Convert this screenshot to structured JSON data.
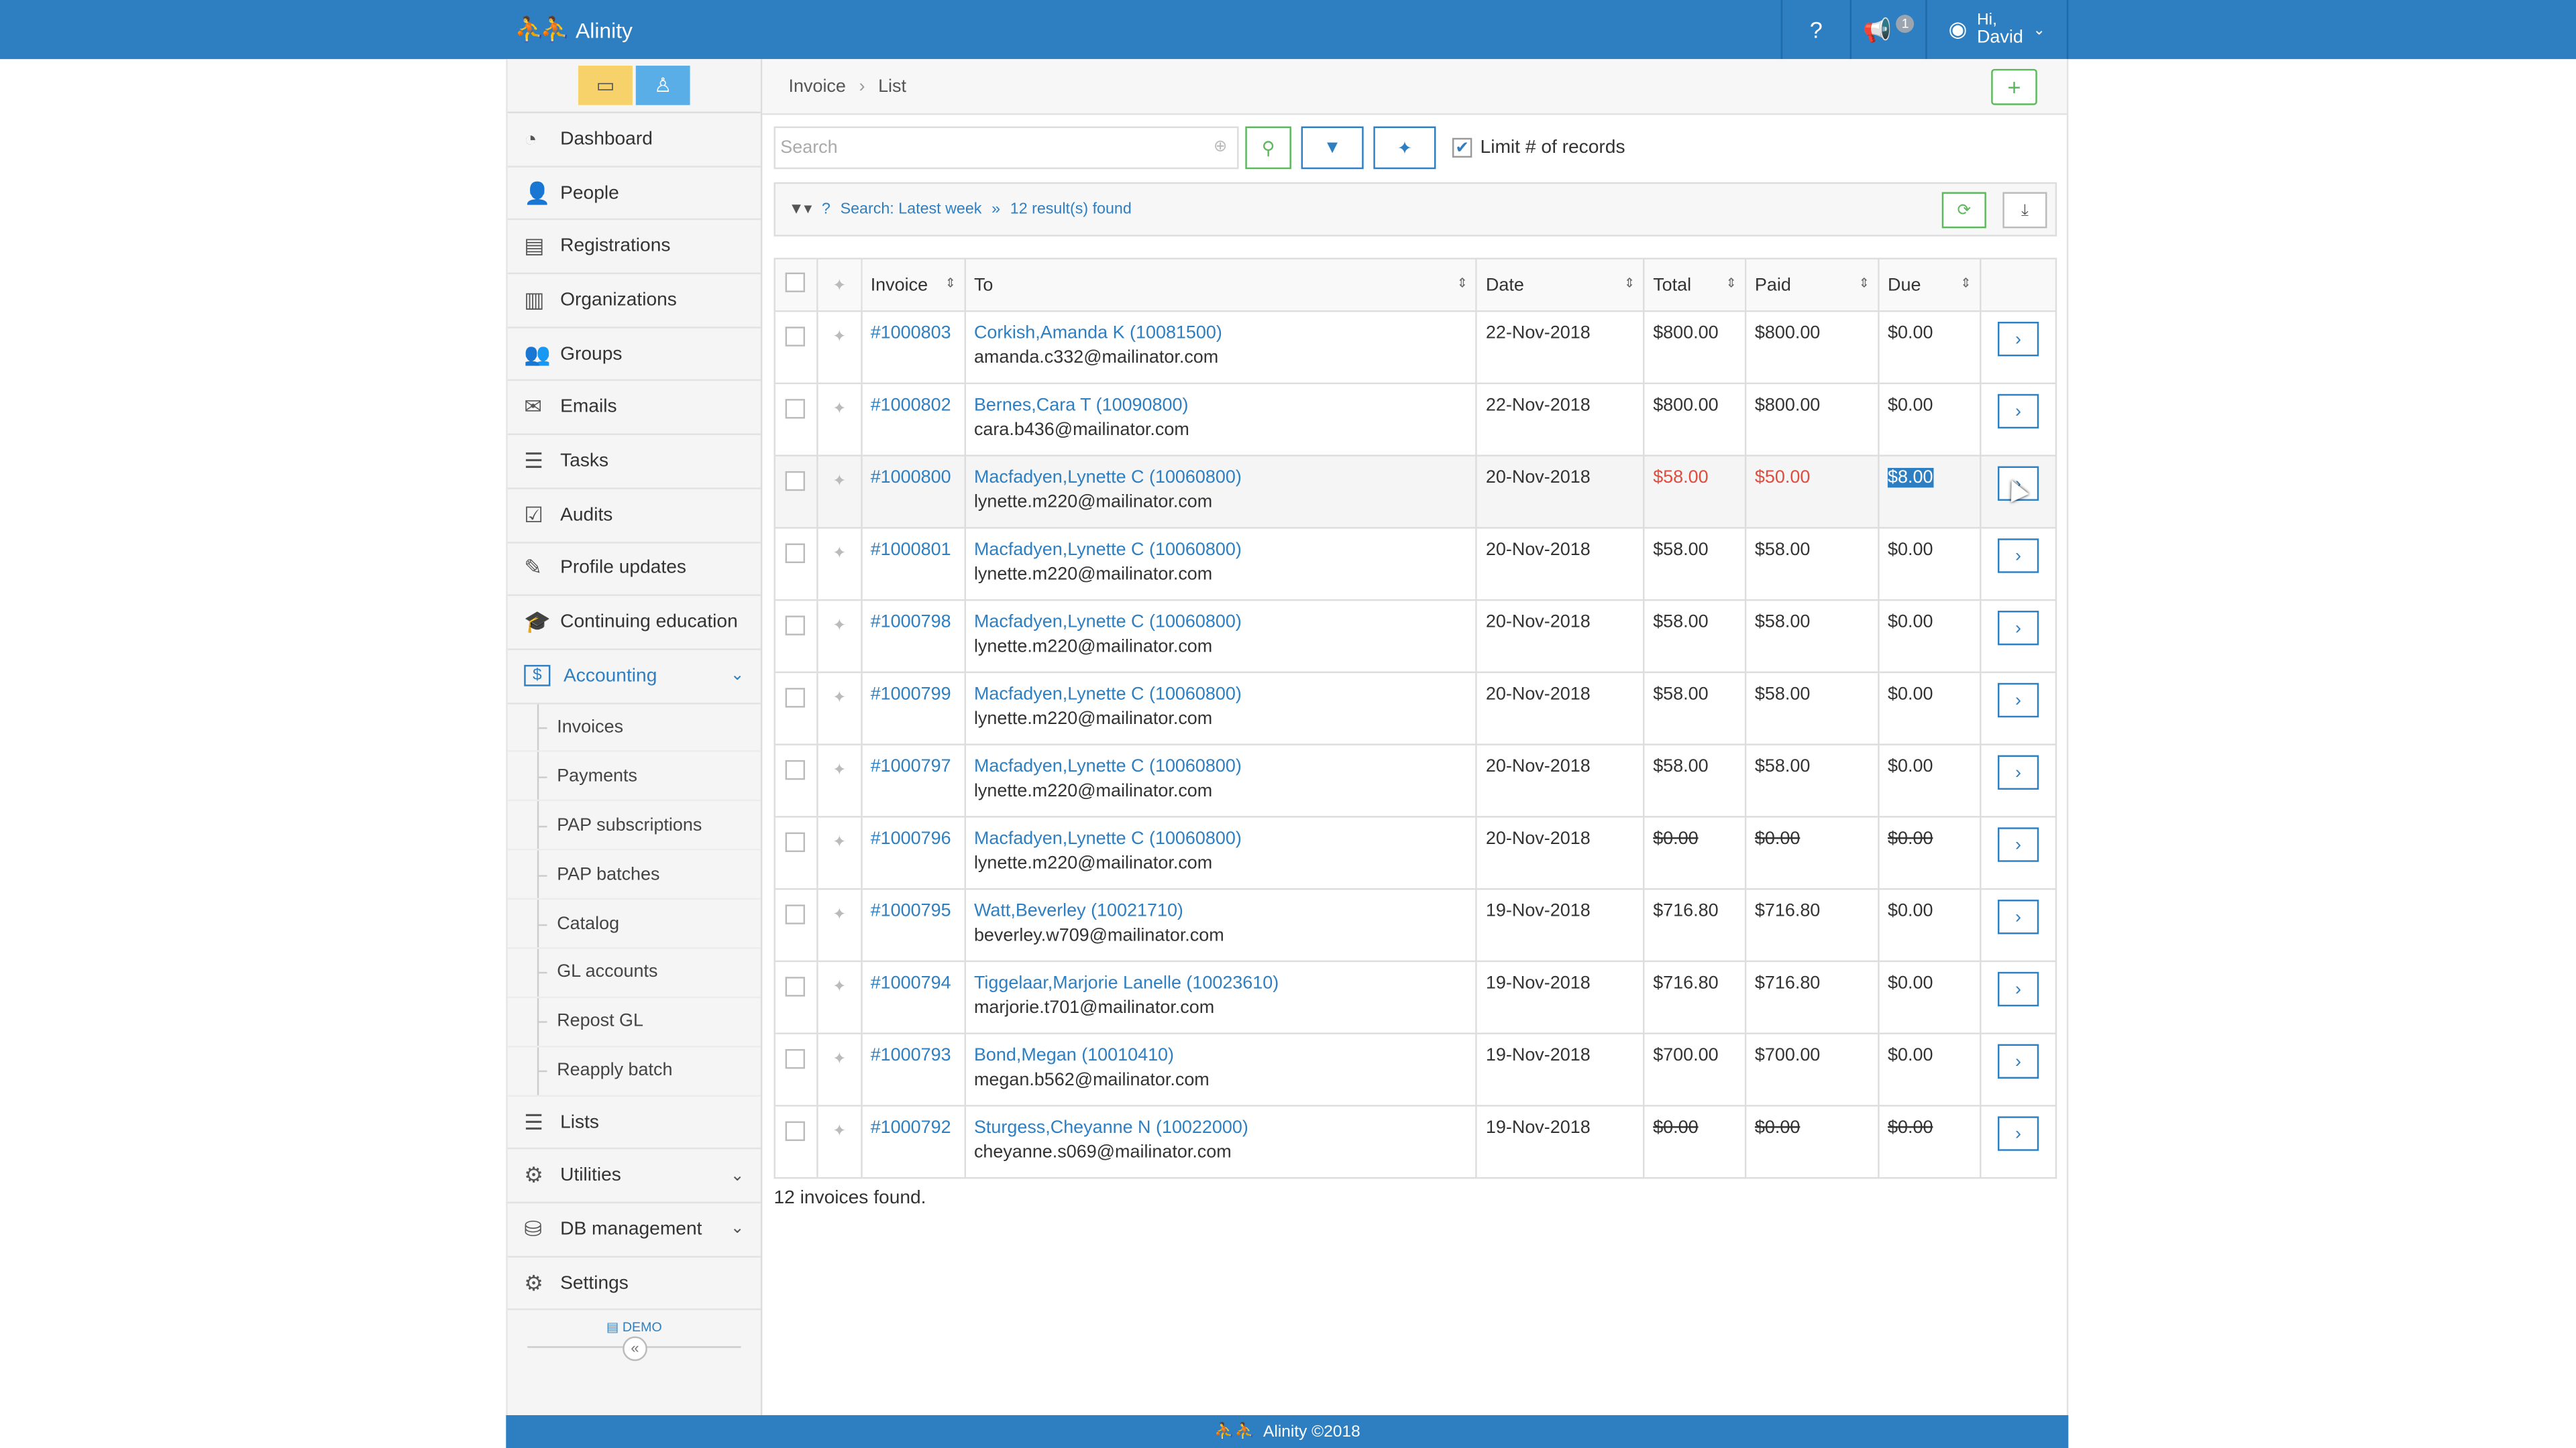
{
  "app": {
    "name": "Alinity",
    "footer": "Alinity ©2018"
  },
  "topbar": {
    "help_icon": "question-icon",
    "notifications_count": "1",
    "user_greeting": "Hi,",
    "user_name": "David"
  },
  "sidebar": {
    "items_top": [
      {
        "label": "Dashboard",
        "icon": "dashboard-icon",
        "glyph": "◔"
      },
      {
        "label": "People",
        "icon": "person-icon",
        "glyph": "👤"
      },
      {
        "label": "Registrations",
        "icon": "id-card-icon",
        "glyph": "▤"
      },
      {
        "label": "Organizations",
        "icon": "building-icon",
        "glyph": "▥"
      },
      {
        "label": "Groups",
        "icon": "group-icon",
        "glyph": "👥"
      },
      {
        "label": "Emails",
        "icon": "envelope-icon",
        "glyph": "✉"
      },
      {
        "label": "Tasks",
        "icon": "tasks-icon",
        "glyph": "☰"
      },
      {
        "label": "Audits",
        "icon": "checkbox-icon",
        "glyph": "☑"
      },
      {
        "label": "Profile updates",
        "icon": "edit-icon",
        "glyph": "✎"
      },
      {
        "label": "Continuing education",
        "icon": "graduation-icon",
        "glyph": "🎓"
      }
    ],
    "accounting": {
      "label": "Accounting",
      "glyph": "$"
    },
    "accounting_sub": [
      "Invoices",
      "Payments",
      "PAP subscriptions",
      "PAP batches",
      "Catalog",
      "GL accounts",
      "Repost GL",
      "Reapply batch"
    ],
    "lists": "Lists",
    "utilities": "Utilities",
    "db_management": "DB management",
    "settings": "Settings",
    "demo": "DEMO"
  },
  "breadcrumb": {
    "first": "Invoice",
    "second": "List"
  },
  "search": {
    "placeholder": "Search",
    "limit_label": "Limit # of records"
  },
  "info": {
    "search_text": "Search: Latest week",
    "results": "12 result(s) found"
  },
  "table": {
    "headers": {
      "invoice": "Invoice",
      "to": "To",
      "date": "Date",
      "total": "Total",
      "paid": "Paid",
      "due": "Due"
    },
    "rows": [
      {
        "invoice": "#1000803",
        "name": "Corkish,Amanda K (10081500)",
        "email": "amanda.c332@mailinator.com",
        "date": "22-Nov-2018",
        "total": "$800.00",
        "paid": "$800.00",
        "due": "$0.00",
        "style": ""
      },
      {
        "invoice": "#1000802",
        "name": "Bernes,Cara T (10090800)",
        "email": "cara.b436@mailinator.com",
        "date": "22-Nov-2018",
        "total": "$800.00",
        "paid": "$800.00",
        "due": "$0.00",
        "style": ""
      },
      {
        "invoice": "#1000800",
        "name": "Macfadyen,Lynette C (10060800)",
        "email": "lynette.m220@mailinator.com",
        "date": "20-Nov-2018",
        "total": "$58.00",
        "paid": "$50.00",
        "due": "$8.00",
        "style": "red"
      },
      {
        "invoice": "#1000801",
        "name": "Macfadyen,Lynette C (10060800)",
        "email": "lynette.m220@mailinator.com",
        "date": "20-Nov-2018",
        "total": "$58.00",
        "paid": "$58.00",
        "due": "$0.00",
        "style": ""
      },
      {
        "invoice": "#1000798",
        "name": "Macfadyen,Lynette C (10060800)",
        "email": "lynette.m220@mailinator.com",
        "date": "20-Nov-2018",
        "total": "$58.00",
        "paid": "$58.00",
        "due": "$0.00",
        "style": ""
      },
      {
        "invoice": "#1000799",
        "name": "Macfadyen,Lynette C (10060800)",
        "email": "lynette.m220@mailinator.com",
        "date": "20-Nov-2018",
        "total": "$58.00",
        "paid": "$58.00",
        "due": "$0.00",
        "style": ""
      },
      {
        "invoice": "#1000797",
        "name": "Macfadyen,Lynette C (10060800)",
        "email": "lynette.m220@mailinator.com",
        "date": "20-Nov-2018",
        "total": "$58.00",
        "paid": "$58.00",
        "due": "$0.00",
        "style": ""
      },
      {
        "invoice": "#1000796",
        "name": "Macfadyen,Lynette C (10060800)",
        "email": "lynette.m220@mailinator.com",
        "date": "20-Nov-2018",
        "total": "$0.00",
        "paid": "$0.00",
        "due": "$0.00",
        "style": "strike"
      },
      {
        "invoice": "#1000795",
        "name": "Watt,Beverley (10021710)",
        "email": "beverley.w709@mailinator.com",
        "date": "19-Nov-2018",
        "total": "$716.80",
        "paid": "$716.80",
        "due": "$0.00",
        "style": ""
      },
      {
        "invoice": "#1000794",
        "name": "Tiggelaar,Marjorie Lanelle (10023610)",
        "email": "marjorie.t701@mailinator.com",
        "date": "19-Nov-2018",
        "total": "$716.80",
        "paid": "$716.80",
        "due": "$0.00",
        "style": ""
      },
      {
        "invoice": "#1000793",
        "name": "Bond,Megan (10010410)",
        "email": "megan.b562@mailinator.com",
        "date": "19-Nov-2018",
        "total": "$700.00",
        "paid": "$700.00",
        "due": "$0.00",
        "style": ""
      },
      {
        "invoice": "#1000792",
        "name": "Sturgess,Cheyanne N (10022000)",
        "email": "cheyanne.s069@mailinator.com",
        "date": "19-Nov-2018",
        "total": "$0.00",
        "paid": "$0.00",
        "due": "$0.00",
        "style": "strike"
      }
    ],
    "summary": "12 invoices found."
  },
  "colors": {
    "brand": "#2d7fc2",
    "success": "#5cb85c",
    "danger": "#e04c3d"
  }
}
